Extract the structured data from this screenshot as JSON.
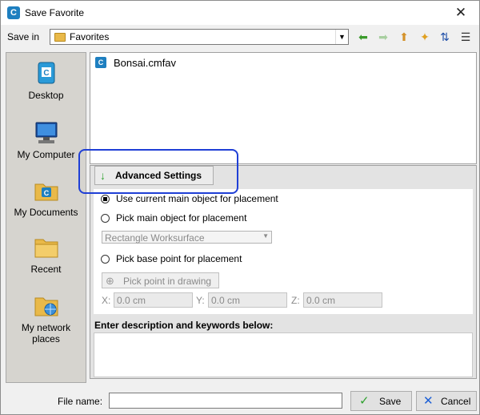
{
  "window": {
    "title": "Save Favorite",
    "close_glyph": "✕"
  },
  "savein": {
    "label": "Save in",
    "value": "Favorites"
  },
  "toolbar": {
    "back_glyph": "⬅",
    "forward_glyph": "➡",
    "up_glyph": "⬆",
    "new_folder_glyph": "✦",
    "sort_glyph": "⇅",
    "view_glyph": "☰"
  },
  "places": [
    {
      "label": "Desktop"
    },
    {
      "label": "My Computer"
    },
    {
      "label": "My Documents"
    },
    {
      "label": "Recent"
    },
    {
      "label": "My network places"
    }
  ],
  "files": [
    {
      "name": "Bonsai.cmfav"
    }
  ],
  "advanced": {
    "button_label": "Advanced Settings",
    "opt_current": "Use current main object for placement",
    "opt_pick_main": "Pick main object for placement",
    "object_select": "Rectangle Worksurface",
    "opt_base_point": "Pick base point for placement",
    "pick_point_label": "Pick point in drawing",
    "x_label": "X:",
    "x_value": "0.0 cm",
    "y_label": "Y:",
    "y_value": "0.0 cm",
    "z_label": "Z:",
    "z_value": "0.0 cm",
    "description_label": "Enter description and keywords below:"
  },
  "footer": {
    "filename_label": "File name:",
    "filename_value": "",
    "save_label": "Save",
    "cancel_label": "Cancel"
  },
  "colors": {
    "highlight": "#1f3fd6",
    "accent": "#1e7fc0",
    "save_check": "#2fa12f",
    "cancel_x": "#1c5fd6"
  }
}
